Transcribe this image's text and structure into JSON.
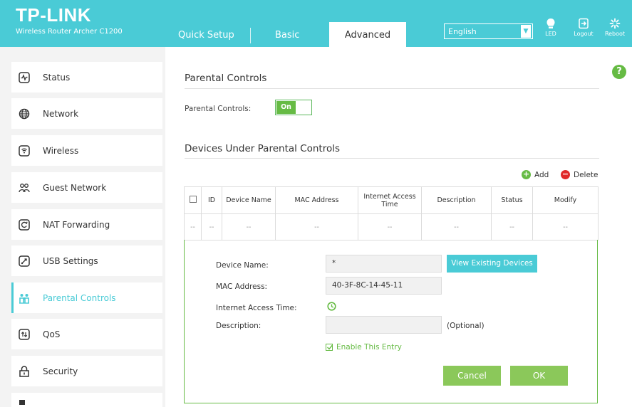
{
  "header": {
    "brand": "TP-LINK",
    "model": "Wireless Router Archer C1200",
    "tabs": [
      {
        "label": "Quick Setup"
      },
      {
        "label": "Basic"
      },
      {
        "label": "Advanced"
      }
    ],
    "language": "English",
    "icons": [
      {
        "label": "LED",
        "icon": "bulb-icon"
      },
      {
        "label": "Logout",
        "icon": "logout-icon"
      },
      {
        "label": "Reboot",
        "icon": "reboot-icon"
      }
    ]
  },
  "sidebar": {
    "items": [
      {
        "label": "Status",
        "icon": "status-icon"
      },
      {
        "label": "Network",
        "icon": "globe-icon"
      },
      {
        "label": "Wireless",
        "icon": "wifi-icon"
      },
      {
        "label": "Guest Network",
        "icon": "guest-icon"
      },
      {
        "label": "NAT Forwarding",
        "icon": "nat-icon"
      },
      {
        "label": "USB Settings",
        "icon": "usb-icon"
      },
      {
        "label": "Parental Controls",
        "icon": "family-icon",
        "active": true
      },
      {
        "label": "QoS",
        "icon": "qos-icon"
      },
      {
        "label": "Security",
        "icon": "lock-icon"
      }
    ]
  },
  "main": {
    "section_title": "Parental Controls",
    "toggle_label": "Parental Controls:",
    "toggle_value": "On",
    "devices_title": "Devices Under Parental Controls",
    "add_label": "Add",
    "delete_label": "Delete",
    "table": {
      "headers": [
        "ID",
        "Device Name",
        "MAC Address",
        "Internet Access Time",
        "Description",
        "Status",
        "Modify"
      ],
      "row": [
        "--",
        "--",
        "--",
        "--",
        "--",
        "--",
        "--",
        "--"
      ]
    },
    "form": {
      "device_name_label": "Device Name:",
      "device_name_value": "*",
      "view_button": "View Existing Devices",
      "mac_label": "MAC Address:",
      "mac_value": "40-3F-8C-14-45-11",
      "access_label": "Internet Access Time:",
      "description_label": "Description:",
      "description_value": "",
      "optional": "(Optional)",
      "enable_label": "Enable This Entry",
      "cancel": "Cancel",
      "ok": "OK"
    }
  },
  "colors": {
    "brand": "#4acbd6",
    "accent_green": "#66bb44",
    "button_green": "#8bc85a",
    "delete_red": "#e02a2a"
  }
}
